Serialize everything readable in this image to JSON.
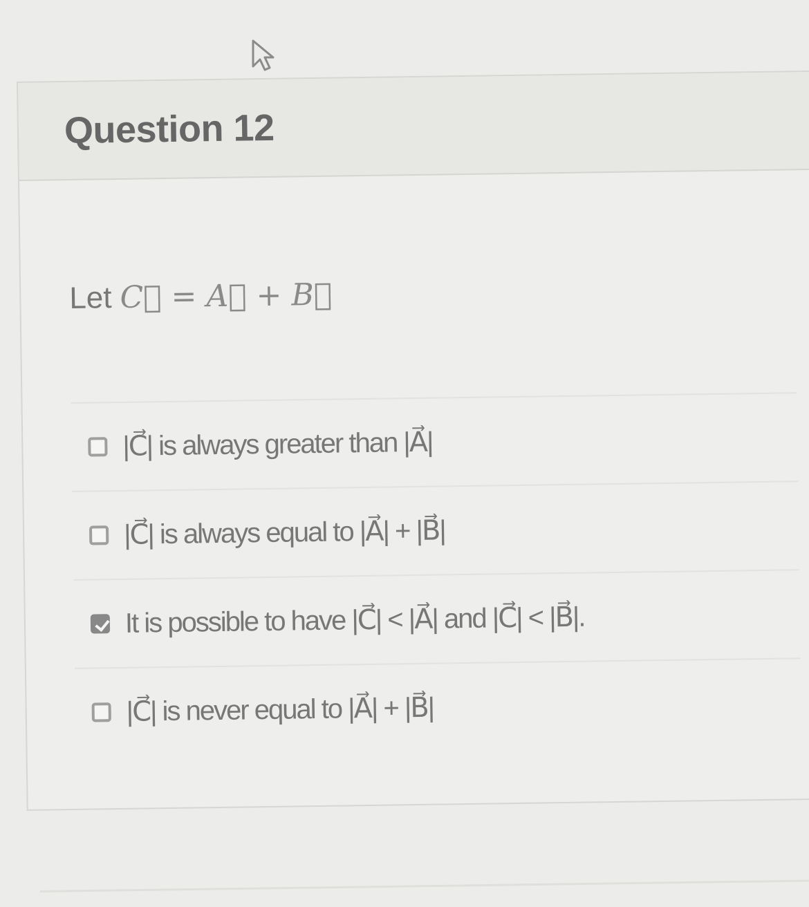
{
  "question": {
    "title": "Question 12",
    "prompt_prefix": "Let",
    "prompt_formula": "C⃗ = A⃗ + B⃗"
  },
  "answers": [
    {
      "label": "|C⃗| is always greater than |A⃗|",
      "checked": false
    },
    {
      "label": "|C⃗| is always equal to |A⃗| + |B⃗|",
      "checked": false
    },
    {
      "label": "It is possible to have |C⃗| < |A⃗| and |C⃗| < |B⃗|.",
      "checked": true
    },
    {
      "label": "|C⃗| is never equal to |A⃗| + |B⃗|",
      "checked": false
    }
  ],
  "icons": {
    "cursor": "mouse-pointer-icon",
    "checkbox": "checkbox-icon"
  }
}
